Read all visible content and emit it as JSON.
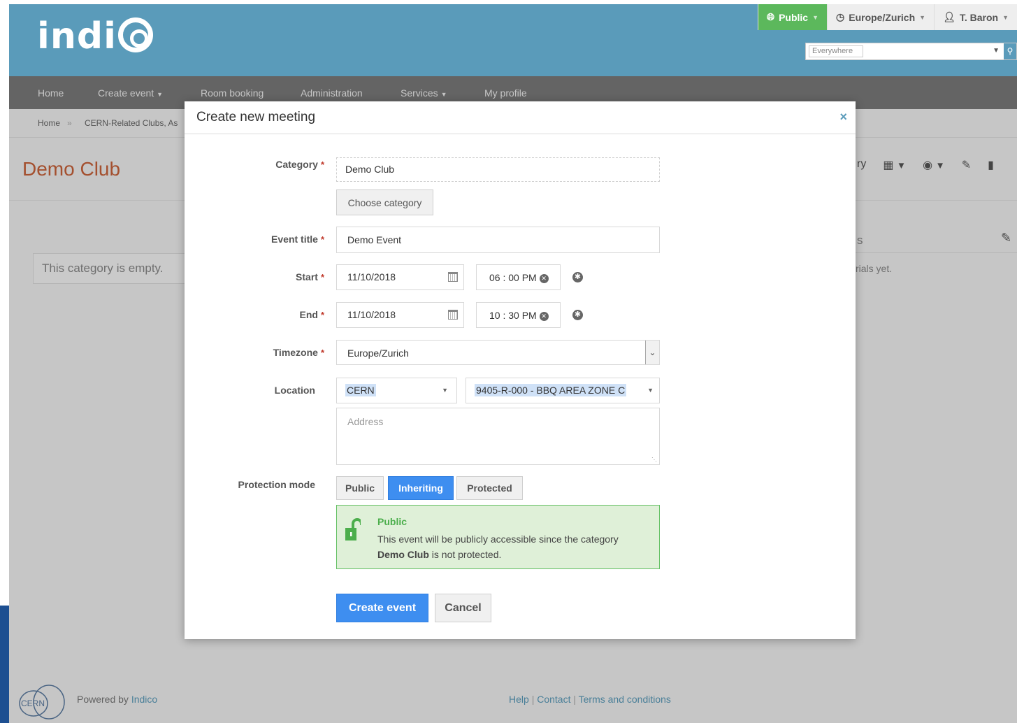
{
  "header": {
    "logo_text": "indico",
    "public_label": "Public",
    "timezone_label": "Europe/Zurich",
    "user_label": "T. Baron",
    "search_scope": "Everywhere"
  },
  "nav": {
    "items": [
      "Home",
      "Create event",
      "Room booking",
      "Administration",
      "Services",
      "My profile"
    ]
  },
  "breadcrumb": {
    "home": "Home",
    "separator": "»",
    "current": "CERN-Related Clubs, As"
  },
  "category": {
    "title": "Demo Club",
    "empty_text": "This category is empty.",
    "right_tools_label": "ry",
    "right_section_label": "s",
    "right_materials_text": "rials yet."
  },
  "footer": {
    "logo_text": "CERN",
    "powered_by": "Powered by",
    "powered_link": "Indico",
    "help": "Help",
    "contact": "Contact",
    "terms": "Terms and conditions",
    "separator": "|"
  },
  "modal": {
    "title": "Create new meeting",
    "close_symbol": "×",
    "required_mark": "*",
    "category_label": "Category",
    "category_value": "Demo Club",
    "choose_category": "Choose category",
    "title_label": "Event title",
    "title_value": "Demo Event",
    "start_label": "Start",
    "start_date": "11/10/2018",
    "start_time": "06 : 00  PM",
    "end_label": "End",
    "end_date": "11/10/2018",
    "end_time": "10 : 30  PM",
    "timezone_label": "Timezone",
    "timezone_value": "Europe/Zurich",
    "location_label": "Location",
    "venue_value": "CERN",
    "room_value": "9405-R-000 - BBQ AREA ZONE C",
    "address_placeholder": "Address",
    "protection_label": "Protection mode",
    "protection_options": [
      "Public",
      "Inheriting",
      "Protected"
    ],
    "protection_selected": "Inheriting",
    "notice_title": "Public",
    "notice_text_1": "This event will be publicly accessible since the category",
    "notice_text_bold": "Demo Club",
    "notice_text_2": "is not protected.",
    "create_button": "Create event",
    "cancel_button": "Cancel"
  },
  "colors": {
    "header_bg": "#5a9bba",
    "nav_bg": "#7a7a7a",
    "accent_public": "#5cb85c",
    "primary_button": "#3e8ef0",
    "category_title": "#c9623a"
  }
}
